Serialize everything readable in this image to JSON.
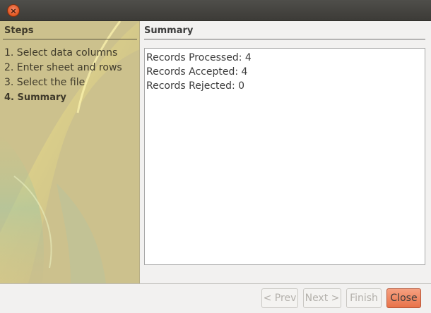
{
  "window": {
    "close_glyph": "×"
  },
  "sidebar": {
    "title": "Steps",
    "steps": [
      {
        "label": "1. Select data columns"
      },
      {
        "label": "2. Enter sheet and rows"
      },
      {
        "label": "3. Select the file"
      },
      {
        "label": "4. Summary"
      }
    ],
    "current_step_index": 3
  },
  "main": {
    "title": "Summary",
    "lines": [
      "Records Processed: 4",
      "Records Accepted: 4",
      "Records Rejected: 0"
    ]
  },
  "footer": {
    "prev_label": "< Prev",
    "next_label": "Next >",
    "finish_label": "Finish",
    "close_label": "Close"
  },
  "colors": {
    "sidebar_bg": "#ccc18d",
    "close_button_accent": "#e8734a"
  }
}
